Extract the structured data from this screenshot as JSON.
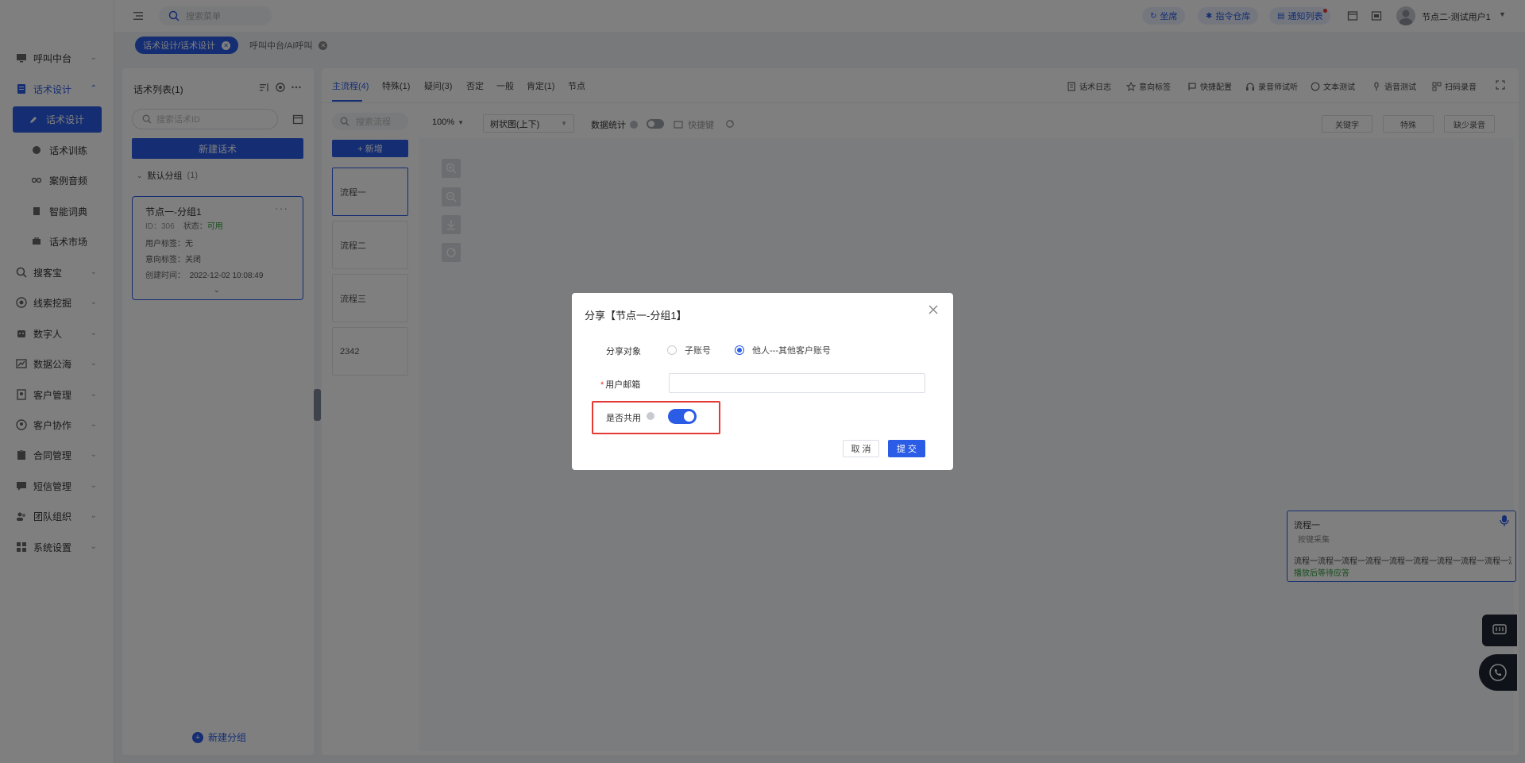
{
  "nav": {
    "call_center": "呼叫中台",
    "script_design": "话术设计",
    "sub_items": [
      "话术设计",
      "话术训练",
      "案例音频",
      "智能词典",
      "话术市场"
    ],
    "items": [
      "搜客宝",
      "线索挖掘",
      "数字人",
      "数据公海",
      "客户管理",
      "客户协作",
      "合同管理",
      "短信管理",
      "团队组织",
      "系统设置"
    ]
  },
  "topbar": {
    "search_placeholder": "搜索菜单",
    "pill_seat": "坐席",
    "pill_command": "指令仓库",
    "pill_notify": "通知列表",
    "user_name": "节点二-测试用户1"
  },
  "page_tabs": {
    "active": "话术设计/话术设计",
    "inactive": "呼叫中台/AI呼叫"
  },
  "list_panel": {
    "title": "话术列表(1)",
    "search_placeholder": "搜索话术ID",
    "new_button": "新建话术",
    "group_name": "默认分组",
    "group_count": "(1)",
    "card": {
      "name": "节点一-分组1",
      "id_text": "ID：306",
      "status_label": "状态：",
      "status_value": "可用",
      "user_tag": "用户标签：无",
      "intent_tag": "意向标签：关闭",
      "created_label": "创建时间：",
      "created_value": "2022-12-02 10:08:49"
    },
    "new_group": "新建分组"
  },
  "flow_tabs": [
    "主流程(4)",
    "特殊(1)",
    "疑问(3)",
    "否定",
    "一般",
    "肯定(1)",
    "节点"
  ],
  "tools": [
    "话术日志",
    "意向标签",
    "快捷配置",
    "录音师试听",
    "文本测试",
    "语音测试",
    "扫码录音"
  ],
  "flow": {
    "search_placeholder": "搜索流程",
    "add_button": "+ 新增",
    "items": [
      "流程一",
      "流程二",
      "流程三",
      "2342"
    ]
  },
  "canvas_toolbar": {
    "zoom": "100%",
    "view": "树状图(上下)",
    "stats": "数据统计",
    "hotkey": "快捷键",
    "btn_keyword": "关键字",
    "btn_special": "特殊",
    "btn_missing": "缺少录音"
  },
  "node": {
    "title": "流程一",
    "subtitle": "按键采集",
    "body": "流程一流程一流程一流程一流程一流程一流程一流程一流程一流",
    "wait": "播放后等待应答"
  },
  "modal": {
    "title": "分享【节点一-分组1】",
    "target_label": "分享对象",
    "option_sub": "子账号",
    "option_other": "他人---其他客户账号",
    "email_label": "用户邮箱",
    "shared_label": "是否共用",
    "cancel": "取 消",
    "submit": "提 交"
  },
  "colors": {
    "primary": "#2b5ce6",
    "highlight": "#e53935",
    "success": "#2e9b3a"
  }
}
